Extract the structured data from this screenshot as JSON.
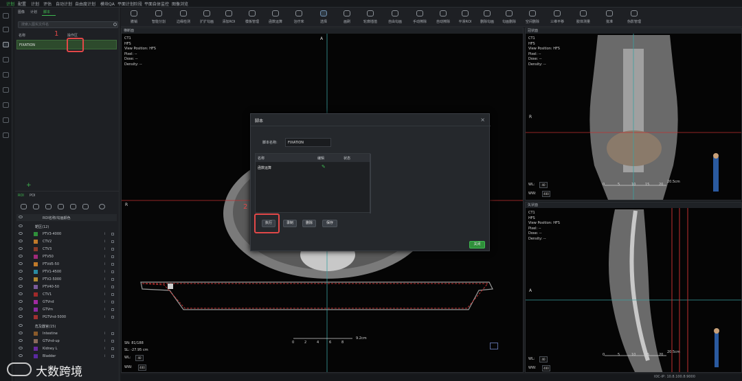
{
  "menu": {
    "items": [
      "计划",
      "配置",
      "计划",
      "评估",
      "自动计划",
      "自由度计划",
      "模块QA",
      "平面计划阶段",
      "平面自体监控",
      "图像浏览"
    ]
  },
  "left_panel": {
    "subtabs": [
      "图像",
      "计划",
      "脚本"
    ],
    "search_placeholder": "搜索入图实文件名",
    "col_name": "名称",
    "col_ops": "操作区",
    "script_row": "FIXATION",
    "annotation1": "1",
    "roi_tabs": [
      "ROI",
      "POI"
    ],
    "roi_header": "ROI名称/勾画颜色",
    "group_targets": "靶区(12)",
    "group_oars": "危及器官(15)",
    "rois": [
      {
        "name": "PTV3-4000",
        "color": "#2f8f3a"
      },
      {
        "name": "CTV2",
        "color": "#c07a2a"
      },
      {
        "name": "CTV3",
        "color": "#8a3a2a"
      },
      {
        "name": "PTV50",
        "color": "#a02a7a"
      },
      {
        "name": "PTVd5-50",
        "color": "#c07a2a"
      },
      {
        "name": "PTV1-4500",
        "color": "#2a8aa0"
      },
      {
        "name": "PTV2-5000",
        "color": "#b08a30"
      },
      {
        "name": "PTV40-50",
        "color": "#7a5a9a"
      },
      {
        "name": "CTV1",
        "color": "#a02a2a"
      },
      {
        "name": "GTVnd",
        "color": "#a02aa0"
      },
      {
        "name": "GTVm",
        "color": "#8a2aa0"
      },
      {
        "name": "PGTVnd-5000",
        "color": "#a03030"
      }
    ],
    "oars": [
      {
        "name": "Intestine",
        "color": "#8a5a2a"
      },
      {
        "name": "GTVnd-up",
        "color": "#8a6a5a"
      },
      {
        "name": "Kidney L",
        "color": "#6a2aa0"
      },
      {
        "name": "Bladder",
        "color": "#5a2aa0"
      }
    ]
  },
  "toolbar": {
    "tools": [
      "撤销",
      "智能分割",
      "边缘检测",
      "扩扩勾画",
      "添加ROI",
      "模板管理",
      "函数运算",
      "治疗床",
      "选择",
      "画刷",
      "轮廓插值",
      "自由勾画",
      "手动擦除",
      "自动擦除",
      "平滑ROI",
      "删除勾画",
      "勾画删除",
      "空间删除",
      "三维平移",
      "胶体测量",
      "批准",
      "伪影管理"
    ]
  },
  "views": {
    "axial": {
      "header": "横断面",
      "info": [
        "CT1",
        "HFS",
        "View Position: HFS",
        "Pixel: --",
        "Dose: --",
        "Density: --"
      ],
      "top_label": "A",
      "left_label": "R",
      "sn": "SN: 81/188",
      "sl": "SL: -27.95 cm",
      "wl": "WL:",
      "ww": "WW:",
      "wl_val": "40",
      "ww_val": "400",
      "scale": "9.2cm",
      "ticks": [
        "0",
        "2",
        "4",
        "6",
        "8"
      ]
    },
    "coronal": {
      "header": "冠状面",
      "info": [
        "CT1",
        "HFS",
        "View Position: HFS",
        "Pixel: --",
        "Dose: --",
        "Density: --"
      ],
      "left_label": "R",
      "wl": "WL:",
      "ww": "WW:",
      "wl_val": "40",
      "ww_val": "400",
      "scale": "20.5cm",
      "ticks": [
        "0",
        "5",
        "10",
        "15",
        "20"
      ]
    },
    "sagittal": {
      "header": "矢状面",
      "info": [
        "CT1",
        "HFS",
        "View Position: HFS",
        "Pixel: --",
        "Dose: --",
        "Density: --"
      ],
      "left_label": "A",
      "wl": "WL:",
      "ww": "WW:",
      "wl_val": "40",
      "ww_val": "400",
      "scale": "20.5cm",
      "ticks": [
        "0",
        "5",
        "10",
        "15",
        "20"
      ]
    }
  },
  "dialog": {
    "title": "脚本",
    "name_label": "脚本名称:",
    "name_value": "FIXATION",
    "col_name": "名称",
    "col_edit": "编辑",
    "col_status": "状态",
    "row_name": "函数运算",
    "buttons": {
      "run": "执行",
      "record": "录制",
      "delete": "删除",
      "save": "保存",
      "close": "关闭"
    },
    "annotation2": "2"
  },
  "footer": {
    "ip": "IOC-IP: 10.8.100.8:9000"
  },
  "watermark": "大数跨境"
}
